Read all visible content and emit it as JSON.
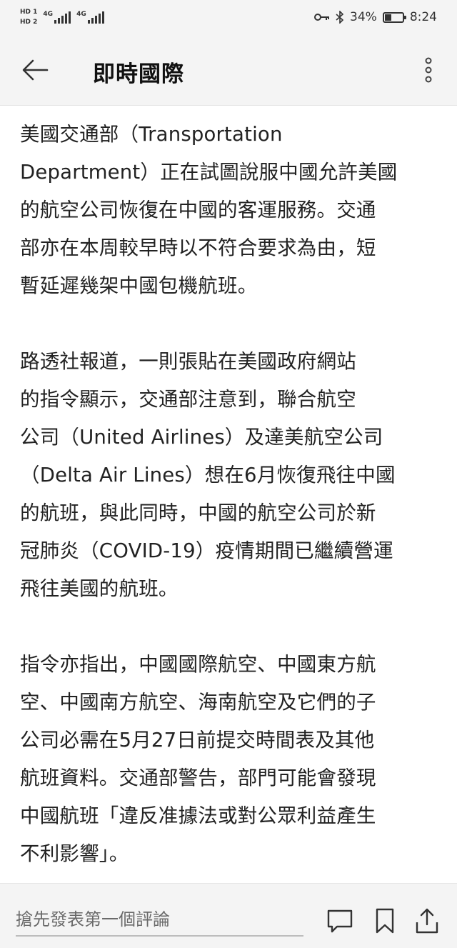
{
  "status_bar": {
    "hd1": "HD 1",
    "hd2": "HD 2",
    "signal1_label": "4G",
    "signal2_label": "4G",
    "battery_text": "34%",
    "battery_level": 0.34,
    "time": "8:24",
    "icons": [
      "key-icon",
      "bluetooth-icon",
      "battery-icon"
    ]
  },
  "header": {
    "title": "即時國際",
    "back_icon": "arrow-left-icon",
    "more_icon": "more-vertical-icon"
  },
  "article": {
    "paragraphs": [
      "美國交通部（Transportation\nDepartment）正在試圖說服中國允許美國\n的航空公司恢復在中國的客運服務。交通\n部亦在本周較早時以不符合要求為由，短\n暫延遲幾架中國包機航班。",
      "路透社報道，一則張貼在美國政府網站\n的指令顯示，交通部注意到，聯合航空\n公司（United Airlines）及達美航空公司\n（Delta Air Lines）想在6月恢復飛往中國\n的航班，與此同時，中國的航空公司於新\n冠肺炎（COVID-19）疫情期間已繼續營運\n飛往美國的航班。",
      "指令亦指出，中國國際航空、中國東方航\n空、中國南方航空、海南航空及它們的子\n公司必需在5月27日前提交時間表及其他\n航班資料。交通部警告，部門可能會發現\n中國航班「違反准據法或對公眾利益產生\n不利影響」。"
    ]
  },
  "bottom_bar": {
    "comment_placeholder": "搶先發表第一個評論",
    "icons": [
      "comment-icon",
      "bookmark-icon",
      "share-icon"
    ]
  }
}
